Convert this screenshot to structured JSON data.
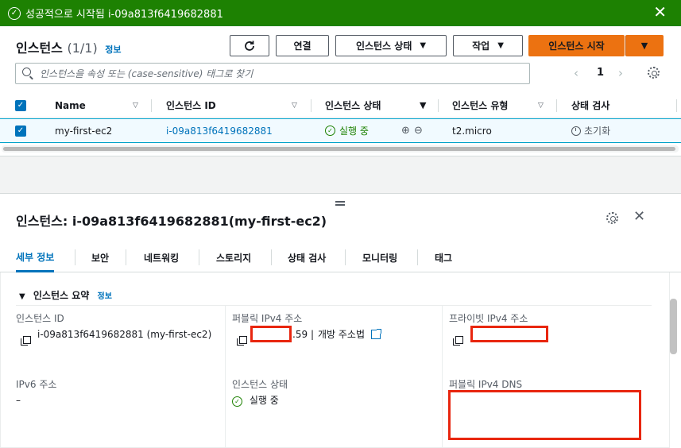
{
  "banner": {
    "message": "성공적으로 시작됨 i-09a813f6419682881",
    "icon": "check-circle-icon",
    "color": "#1d8102"
  },
  "header": {
    "title": "인스턴스",
    "count": "(1/1)",
    "info": "정보",
    "buttons": {
      "refresh": "refresh-icon",
      "connect": "연결",
      "state": "인스턴스 상태",
      "actions": "작업",
      "launch": "인스턴스 시작"
    },
    "search_placeholder": "인스턴스을 속성 또는 (case-sensitive) 태그로 찾기",
    "page": "1"
  },
  "table": {
    "columns": [
      "Name",
      "인스턴스 ID",
      "인스턴스 상태",
      "인스턴스 유형",
      "상태 검사"
    ],
    "rows": [
      {
        "name": "my-first-ec2",
        "id": "i-09a813f6419682881",
        "state": "실행 중",
        "type": "t2.micro",
        "check": "초기화"
      }
    ]
  },
  "detail": {
    "title": "인스턴스: i-09a813f6419682881(my-first-ec2)",
    "tabs": [
      "세부 정보",
      "보안",
      "네트워킹",
      "스토리지",
      "상태 검사",
      "모니터링",
      "태그"
    ],
    "section": {
      "title": "인스턴스 요약",
      "info": "정보"
    },
    "fields": {
      "instance_id_label": "인스턴스 ID",
      "instance_id_value": "i-09a813f6419682881 (my-first-ec2)",
      "public_ipv4_label": "퍼블릭 IPv4 주소",
      "public_ipv4_suffix": ".59",
      "open_address": "개방 주소법",
      "private_ipv4_label": "프라이빗 IPv4 주소",
      "ipv6_label": "IPv6 주소",
      "ipv6_value": "–",
      "state_label": "인스턴스 상태",
      "state_value": "실행 중",
      "public_dns_label": "퍼블릭 IPv4 DNS"
    }
  },
  "colors": {
    "accent": "#0073bb",
    "primary_button": "#ec7211",
    "success": "#1d8102",
    "redaction": "#e8260f"
  }
}
